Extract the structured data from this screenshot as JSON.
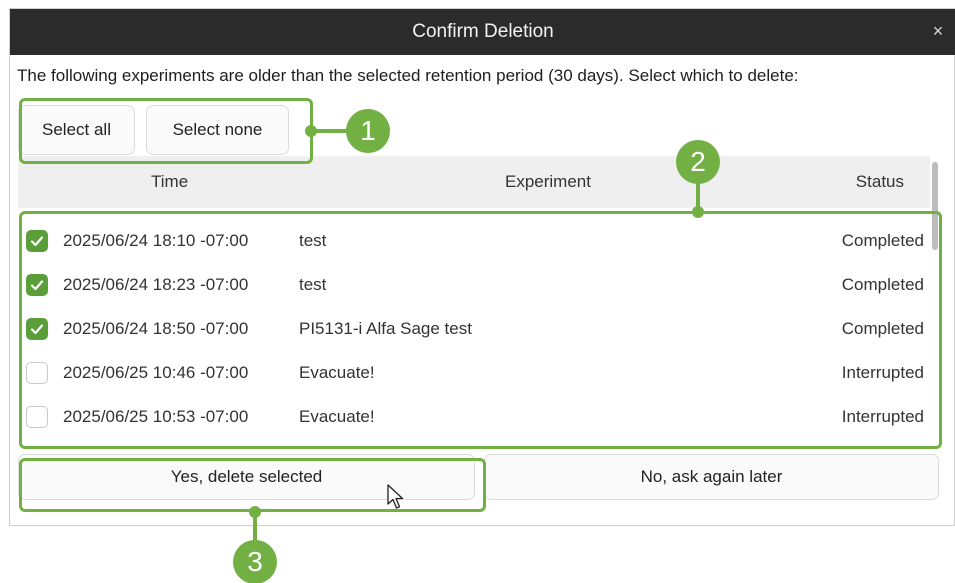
{
  "dialog": {
    "title": "Confirm Deletion",
    "close_glyph": "×",
    "message": "The following experiments are older than the selected retention period (30 days). Select which to delete:"
  },
  "selection": {
    "select_all_label": "Select all",
    "select_none_label": "Select none"
  },
  "table": {
    "headers": {
      "time": "Time",
      "experiment": "Experiment",
      "status": "Status"
    },
    "rows": [
      {
        "checked": true,
        "time": "2025/06/24 18:10 -07:00",
        "experiment": "test",
        "status": "Completed"
      },
      {
        "checked": true,
        "time": "2025/06/24 18:23 -07:00",
        "experiment": "test",
        "status": "Completed"
      },
      {
        "checked": true,
        "time": "2025/06/24 18:50 -07:00",
        "experiment": "PI5131-i Alfa Sage test",
        "status": "Completed"
      },
      {
        "checked": false,
        "time": "2025/06/25 10:46 -07:00",
        "experiment": "Evacuate!",
        "status": "Interrupted"
      },
      {
        "checked": false,
        "time": "2025/06/25 10:53 -07:00",
        "experiment": "Evacuate!",
        "status": "Interrupted"
      }
    ]
  },
  "actions": {
    "yes_label": "Yes, delete selected",
    "no_label": "No, ask again later"
  },
  "callouts": [
    "1",
    "2",
    "3"
  ],
  "colors": {
    "accent": "#72b043",
    "checkbox": "#5a9e3a",
    "titlebar": "#2b2b2b"
  }
}
